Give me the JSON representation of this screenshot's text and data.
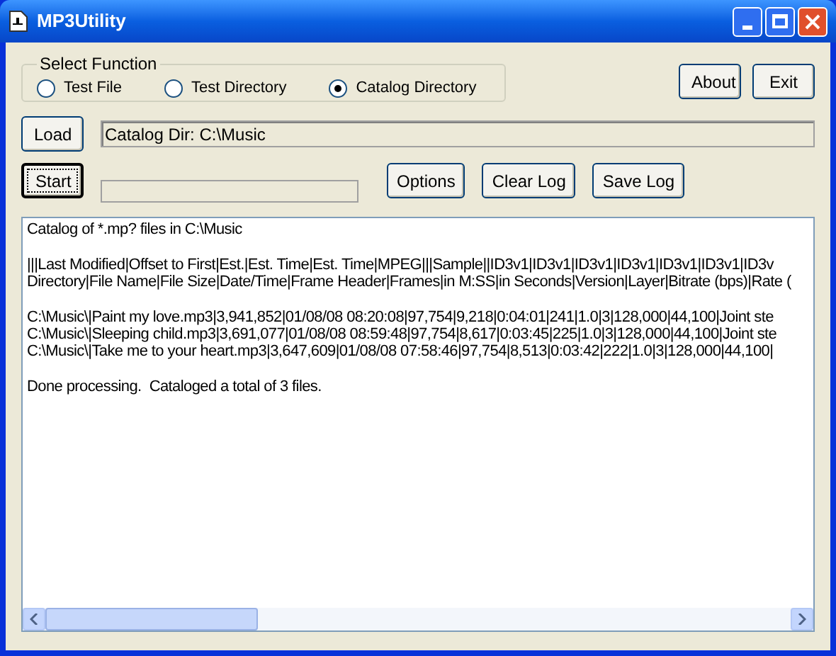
{
  "window": {
    "title": "MP3Utility"
  },
  "function_group": {
    "title": "Select Function",
    "options": [
      {
        "label": "Test File",
        "selected": false
      },
      {
        "label": "Test Directory",
        "selected": false
      },
      {
        "label": "Catalog Directory",
        "selected": true
      }
    ]
  },
  "top_buttons": [
    "About",
    "Exit"
  ],
  "load_button": "Load",
  "dir_field": {
    "value": "Catalog Dir: C:\\Music"
  },
  "start_button": {
    "label": "Start",
    "focused": true
  },
  "progress": {
    "level": 0
  },
  "log_buttons": [
    "Options",
    "Clear Log",
    "Save Log"
  ],
  "log": {
    "blocks": [
      [
        "Catalog of *.mp? files in C:\\Music"
      ],
      [
        "|||Last Modified|Offset to First|Est.|Est. Time|Est. Time|MPEG|||Sample||ID3v1|ID3v1|ID3v1|ID3v1|ID3v1|ID3v1|ID3v",
        "Directory|File Name|File Size|Date/Time|Frame Header|Frames|in M:SS|in Seconds|Version|Layer|Bitrate (bps)|Rate ("
      ],
      [
        "C:\\Music\\|Paint my love.mp3|3,941,852|01/08/08 08:20:08|97,754|9,218|0:04:01|241|1.0|3|128,000|44,100|Joint ste",
        "C:\\Music\\|Sleeping child.mp3|3,691,077|01/08/08 08:59:48|97,754|8,617|0:03:45|225|1.0|3|128,000|44,100|Joint ste",
        "C:\\Music\\|Take me to your heart.mp3|3,647,609|01/08/08 07:58:46|97,754|8,513|0:03:42|222|1.0|3|128,000|44,100|"
      ],
      [
        "Done processing.  Cataloged a total of 3 files."
      ]
    ]
  }
}
